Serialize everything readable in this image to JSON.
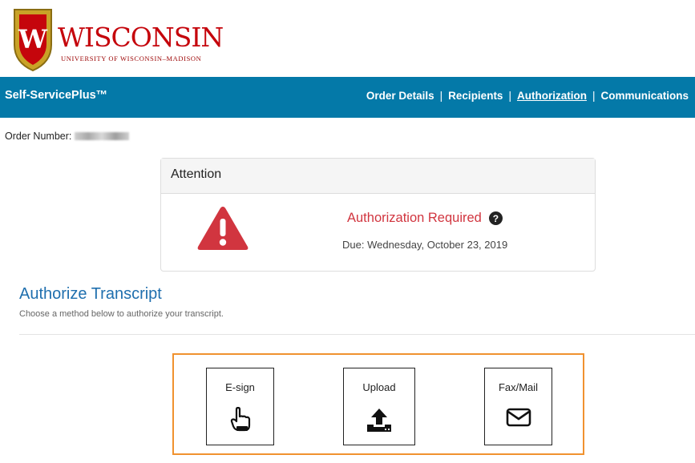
{
  "logo": {
    "wordmark": "WISCONSIN",
    "subtitle": "UNIVERSITY OF WISCONSIN–MADISON",
    "crest_letter": "W"
  },
  "header": {
    "brand": "Self-ServicePlus™",
    "nav": [
      {
        "label": "Order Details",
        "active": false
      },
      {
        "label": "Recipients",
        "active": false
      },
      {
        "label": "Authorization",
        "active": true
      },
      {
        "label": "Communications",
        "active": false
      }
    ],
    "separator": "|"
  },
  "order": {
    "label": "Order Number:"
  },
  "attention": {
    "title": "Attention",
    "status": "Authorization Required",
    "due": "Due: Wednesday, October 23, 2019",
    "help_icon": "question-circle-icon",
    "warning_icon": "warning-triangle-icon"
  },
  "authorize": {
    "title": "Authorize Transcript",
    "subtitle": "Choose a method below to authorize your transcript.",
    "methods": [
      {
        "label": "E-sign",
        "icon": "pointing-hand-icon"
      },
      {
        "label": "Upload",
        "icon": "upload-icon"
      },
      {
        "label": "Fax/Mail",
        "icon": "envelope-icon"
      }
    ]
  },
  "colors": {
    "header_bg": "#0479a8",
    "alert_red": "#d1353f",
    "link_blue": "#1f6fae",
    "highlight_orange": "#f0922f",
    "brand_red": "#c5050c"
  }
}
